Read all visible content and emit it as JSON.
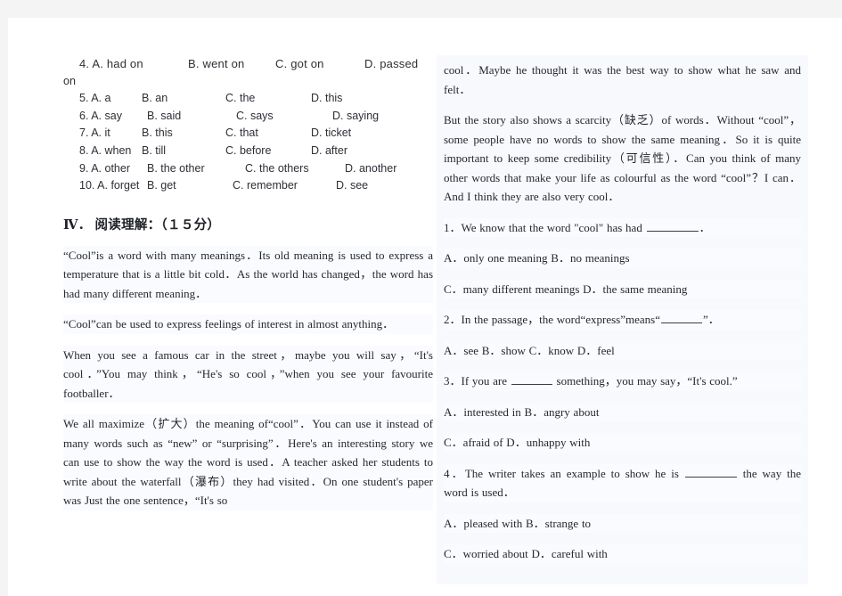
{
  "document": {
    "type": "exam-worksheet",
    "page_background": "#ffffff",
    "right_column_tint": "#f7f9fd"
  },
  "left_column": {
    "multiple_choice": {
      "rows": [
        {
          "number": "4. A. had on",
          "b": "B. went on",
          "c": "C. got on",
          "d": "D. passed",
          "wrap_tail": "on"
        },
        {
          "number": "5. A. a",
          "b": "B. an",
          "c": "C. the",
          "d": "D. this",
          "wrap_tail": ""
        },
        {
          "number": "6. A. say",
          "b": "B. said",
          "c": "C. says",
          "d": "D. saying",
          "wrap_tail": ""
        },
        {
          "number": "7. A. it",
          "b": "B. this",
          "c": "C. that",
          "d": "D. ticket",
          "wrap_tail": ""
        },
        {
          "number": "8. A. when",
          "b": "B. till",
          "c": "C. before",
          "d": "D. after",
          "wrap_tail": ""
        },
        {
          "number": "9. A. other",
          "b": "B. the other",
          "c": "C. the others",
          "d": "D. another",
          "wrap_tail": ""
        },
        {
          "number": "10. A. forget",
          "b": "B. get",
          "c": "C. remember",
          "d": "D. see",
          "wrap_tail": ""
        }
      ]
    },
    "section_heading": "Ⅳ．  阅读理解：（１５分）",
    "passage": {
      "paragraphs": [
        "“Cool”is a word with many meanings．Its old meaning is used to express a temperature that is a little bit cold．As the world has changed，the word has had many different meaning．",
        "“Cool”can be used to express feelings of interest in almost anything．",
        "When you see a famous car in the street，maybe you will say，“It's cool．”You may think，“He's so cool，”when you see your favourite footballer．",
        "We all maximize（扩大）the meaning of“cool”．You can use it instead of many words such as “new” or “surprising”．Here's an interesting story we can use to show the way the word is used．A teacher asked her students to write about the waterfall（瀑布）they had visited．On one student's paper was Just the one sentence，“It's so"
      ]
    }
  },
  "right_column": {
    "passage_continued": [
      "cool．Maybe he thought it was the best way to show what he saw and felt．",
      "But the story also shows a scarcity（缺乏）of words．Without “cool”，some people have no words to show the same meaning．So it is quite important to keep some credibility（可信性）．Can you think of many other words that make your life as colourful as the word “cool”？I can．And I think they are also very cool．"
    ],
    "questions": [
      {
        "stem_before": "1．We know that the word \"cool\" has had ",
        "stem_after": "．",
        "options_line_1": "A．only one meaning  B．no meanings",
        "options_line_2": "C．many different meanings  D．the same meaning"
      },
      {
        "stem_before": "2．In the passage，the word“express”means“",
        "stem_after": "”．",
        "options_line_1": "A．see  B．show  C．know  D．feel",
        "options_line_2": ""
      },
      {
        "stem_before": "3．If you are ",
        "stem_after": " something，you may say，“It's cool.”",
        "options_line_1": "A．interested in  B．angry about",
        "options_line_2": "C．afraid of  D．unhappy with"
      },
      {
        "stem_before": "4．The writer takes an example to show he is ",
        "stem_after": " the way the word is used．",
        "options_line_1": "A．pleased with  B．strange to",
        "options_line_2": "C．worried about  D．careful with"
      }
    ]
  }
}
